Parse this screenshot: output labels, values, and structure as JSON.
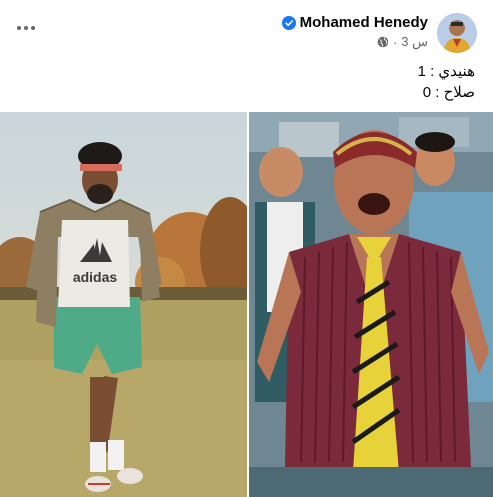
{
  "post": {
    "author": "Mohamed Henedy",
    "timestamp": "3 س",
    "separator": "·",
    "privacy_icon": "globe-icon",
    "verified_icon": "verified-badge-icon",
    "line1": "هنيدي : 1",
    "line2": "صلاح : 0"
  },
  "images": {
    "left_shirt_text": "adidas"
  },
  "colors": {
    "verified": "#1877f2",
    "text_primary": "#050505",
    "text_secondary": "#65676b"
  }
}
